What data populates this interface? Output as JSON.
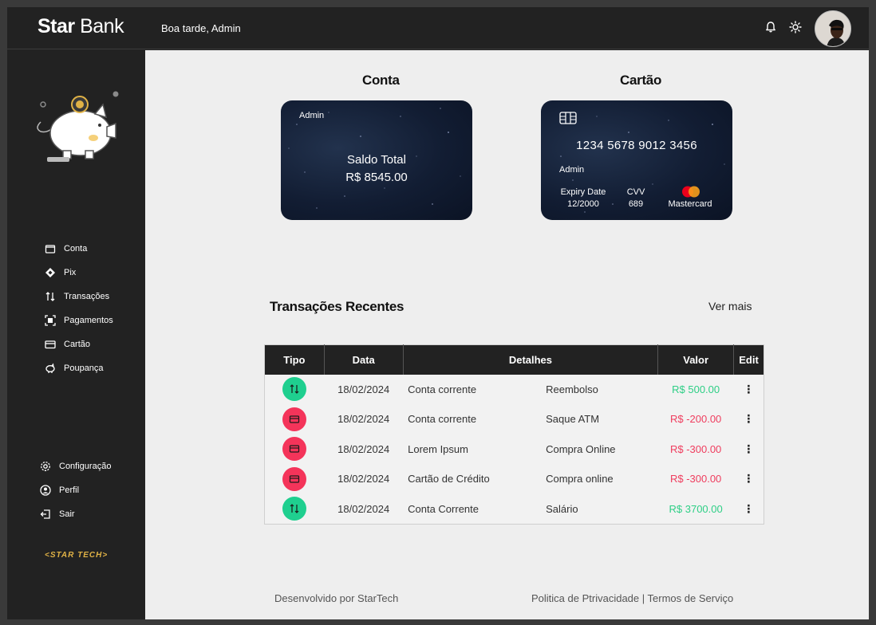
{
  "header": {
    "brand_bold": "Star",
    "brand_light": "Bank",
    "greeting": "Boa tarde, Admin"
  },
  "sidebar": {
    "items": [
      {
        "label": "Conta",
        "icon": "wallet-icon"
      },
      {
        "label": "Pix",
        "icon": "pix-icon"
      },
      {
        "label": "Transações",
        "icon": "transfer-arrows-icon"
      },
      {
        "label": "Pagamentos",
        "icon": "scan-icon"
      },
      {
        "label": "Cartão",
        "icon": "credit-card-icon"
      },
      {
        "label": "Poupança",
        "icon": "piggy-bank-icon"
      }
    ],
    "bottom_items": [
      {
        "label": "Configuração",
        "icon": "gear-icon"
      },
      {
        "label": "Perfil",
        "icon": "user-icon"
      },
      {
        "label": "Sair",
        "icon": "logout-icon"
      }
    ],
    "footer_logo": "<STAR TECH>"
  },
  "account": {
    "section_title": "Conta",
    "holder": "Admin",
    "balance_label": "Saldo Total",
    "balance_value": "R$ 8545.00"
  },
  "card": {
    "section_title": "Cartão",
    "number": "1234 5678 9012 3456",
    "holder": "Admin",
    "expiry_label": "Expiry Date",
    "expiry_value": "12/2000",
    "cvv_label": "CVV",
    "cvv_value": "689",
    "brand": "Mastercard"
  },
  "transactions": {
    "title": "Transações Recentes",
    "see_more": "Ver mais",
    "columns": [
      "Tipo",
      "Data",
      "Detalhes",
      "Valor",
      "Edit"
    ],
    "rows": [
      {
        "type": "in",
        "date": "18/02/2024",
        "account": "Conta corrente",
        "description": "Reembolso",
        "value": "R$ 500.00"
      },
      {
        "type": "out",
        "date": "18/02/2024",
        "account": "Conta corrente",
        "description": "Saque ATM",
        "value": "R$ -200.00"
      },
      {
        "type": "out",
        "date": "18/02/2024",
        "account": "Lorem Ipsum",
        "description": "Compra Online",
        "value": "R$ -300.00"
      },
      {
        "type": "out",
        "date": "18/02/2024",
        "account": "Cartão de Crédito",
        "description": "Compra online",
        "value": "R$ -300.00"
      },
      {
        "type": "in",
        "date": "18/02/2024",
        "account": "Conta Corrente",
        "description": "Salário",
        "value": "R$ 3700.00"
      }
    ]
  },
  "footer": {
    "developed_by": "Desenvolvido por StarTech",
    "privacy": "Politica de Ptrivacidade",
    "separator": "|",
    "terms": "Termos de Serviço"
  },
  "colors": {
    "positive": "#2ecf86",
    "negative": "#ef3d5e",
    "income_badge": "#1fcf8f",
    "expense_badge": "#f4345a",
    "gold": "#e0b246"
  }
}
